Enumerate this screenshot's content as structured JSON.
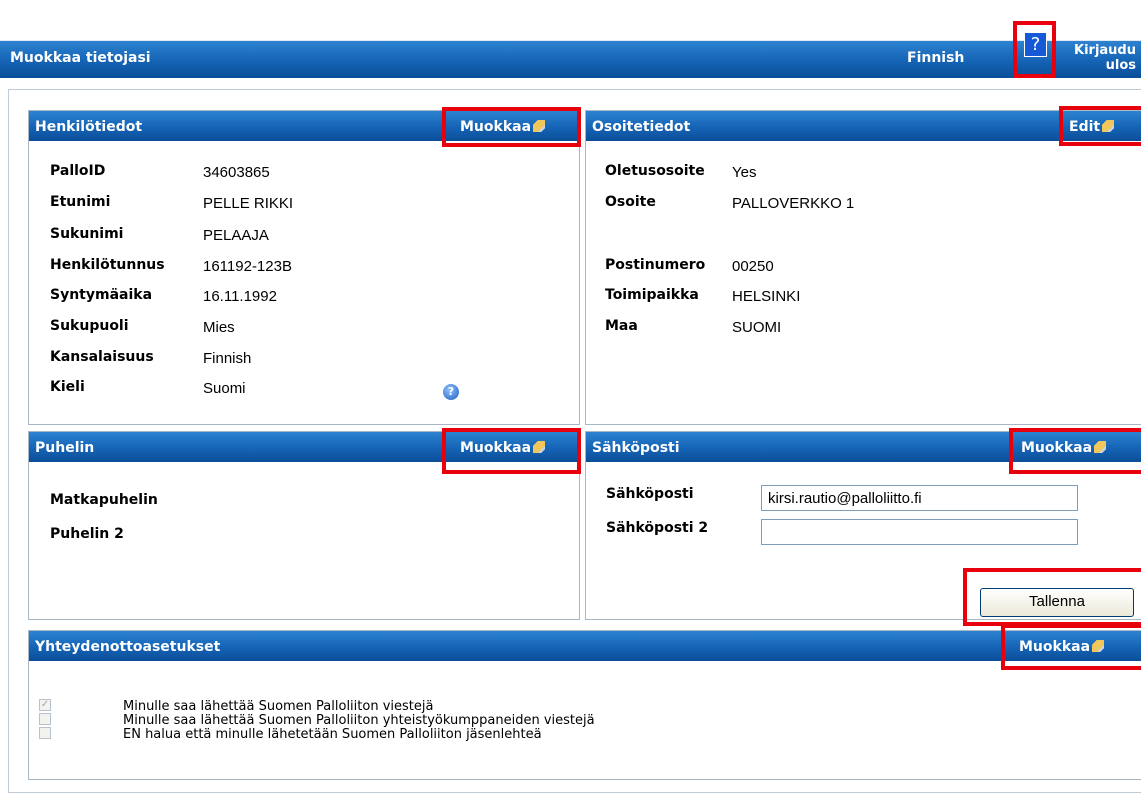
{
  "header": {
    "title": "Muokkaa tietojasi",
    "language": "Finnish",
    "help_label": "?",
    "logout_label_line1": "Kirjaudu",
    "logout_label_line2": "ulos"
  },
  "personal": {
    "heading": "Henkilötiedot",
    "edit_label": "Muokkaa",
    "fields": [
      {
        "label": "PalloID",
        "value": "34603865"
      },
      {
        "label": "Etunimi",
        "value": "PELLE RIKKI"
      },
      {
        "label": "Sukunimi",
        "value": "PELAAJA"
      },
      {
        "label": "Henkilötunnus",
        "value": "161192-123B"
      },
      {
        "label": "Syntymäaika",
        "value": "16.11.1992"
      },
      {
        "label": "Sukupuoli",
        "value": "Mies"
      },
      {
        "label": "Kansalaisuus",
        "value": "Finnish"
      },
      {
        "label": "Kieli",
        "value": "Suomi"
      }
    ],
    "help_icon": "question-icon"
  },
  "address": {
    "heading": "Osoitetiedot",
    "edit_label": "Edit",
    "fields": [
      {
        "label": "Oletusosoite",
        "value": "Yes"
      },
      {
        "label": "Osoite",
        "value": "PALLOVERKKO 1"
      },
      {
        "label": "Postinumero",
        "value": "00250"
      },
      {
        "label": "Toimipaikka",
        "value": "HELSINKI"
      },
      {
        "label": "Maa",
        "value": "SUOMI"
      }
    ]
  },
  "phone": {
    "heading": "Puhelin",
    "edit_label": "Muokkaa",
    "fields": [
      {
        "label": "Matkapuhelin",
        "value": ""
      },
      {
        "label": "Puhelin 2",
        "value": ""
      }
    ]
  },
  "email": {
    "heading": "Sähköposti",
    "edit_label": "Muokkaa",
    "fields": [
      {
        "label": "Sähköposti",
        "value": "kirsi.rautio@palloliitto.fi"
      },
      {
        "label": "Sähköposti 2",
        "value": ""
      }
    ],
    "save_label": "Tallenna"
  },
  "contact": {
    "heading": "Yhteydenottoasetukset",
    "edit_label": "Muokkaa",
    "options": [
      {
        "label": "Minulle saa lähettää Suomen Palloliiton viestejä",
        "checked": true
      },
      {
        "label": "Minulle saa lähettää Suomen Palloliiton yhteistyökumppaneiden viestejä",
        "checked": false
      },
      {
        "label": "EN halua että minulle lähetetään Suomen Palloliiton jäsenlehteä",
        "checked": false
      }
    ]
  },
  "colors": {
    "header_blue": "#1563b5",
    "highlight_red": "#e8000d"
  },
  "icons": {
    "edit": "pencil-icon",
    "help": "question-icon"
  }
}
